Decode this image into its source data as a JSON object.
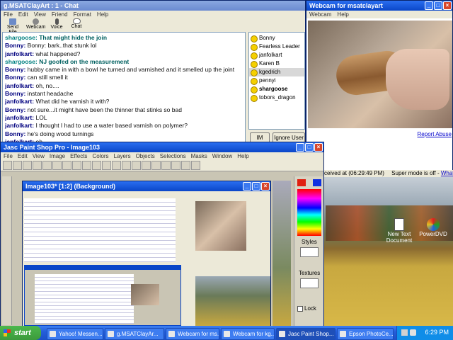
{
  "chat_window": {
    "title": "g.MSATClayArt : 1 - Chat",
    "menu": [
      "File",
      "Edit",
      "View",
      "Friend",
      "Format",
      "Help"
    ],
    "toolbar": [
      "Send File",
      "Webcam",
      "Voice",
      "Chat"
    ],
    "messages": [
      {
        "nick": "shargoose:",
        "text": "That might hide the join",
        "style": "bold"
      },
      {
        "nick": "Bonny:",
        "text": "Bonny: bark..that stunk lol",
        "style": "plain"
      },
      {
        "nick": "janfolkart:",
        "text": "what happened?",
        "style": "plain"
      },
      {
        "nick": "shargoose:",
        "text": "NJ goofed on the measurement",
        "style": "bold"
      },
      {
        "nick": "Bonny:",
        "text": "hubby came in with a bowl he turned and varnished and it smelled up the joint",
        "style": "plain"
      },
      {
        "nick": "Bonny:",
        "text": "can still smell it",
        "style": "plain"
      },
      {
        "nick": "janfolkart:",
        "text": "oh, no....",
        "style": "plain"
      },
      {
        "nick": "Bonny:",
        "text": "instant headache",
        "style": "plain"
      },
      {
        "nick": "janfolkart:",
        "text": "What did he varnish it with?",
        "style": "plain"
      },
      {
        "nick": "Bonny:",
        "text": "not sure...it might have been the thinner that stinks so bad",
        "style": "plain"
      },
      {
        "nick": "janfolkart:",
        "text": "LOL",
        "style": "plain"
      },
      {
        "nick": "janfolkart:",
        "text": "I thought I had to use a water based varnish on polymer?",
        "style": "plain"
      },
      {
        "nick": "Bonny:",
        "text": "he's doing wood turnings",
        "style": "plain"
      },
      {
        "nick": "janfolkart:",
        "text": "oh",
        "style": "plain"
      }
    ],
    "users": [
      "Bonny",
      "Fearless Leader",
      "janfolkart",
      "Karen B",
      "kgedrich",
      "pennyi",
      "shargoose",
      "tobors_dragon"
    ],
    "selected_user": "kgedrich",
    "im_button": "IM",
    "ignore_button": "Ignore User"
  },
  "webcam_window": {
    "title": "Webcam for msatclayart",
    "menu": [
      "Webcam",
      "Help"
    ],
    "report_link": "Report Abuse",
    "received_text": "ceived at (06:29:49 PM)",
    "super_mode_text": "Super mode is off -",
    "whats_this_link": "What's this?"
  },
  "psp_window": {
    "title": "Jasc Paint Shop Pro - Image103",
    "menu": [
      "File",
      "Edit",
      "View",
      "Image",
      "Effects",
      "Colors",
      "Layers",
      "Objects",
      "Selections",
      "Masks",
      "Window",
      "Help"
    ],
    "image_title": "Image103* [1:2] (Background)",
    "panel_styles": "Styles",
    "panel_textures": "Textures",
    "lock_label": "Lock"
  },
  "desktop": {
    "icons": [
      "New Text Document",
      "PowerDVD"
    ]
  },
  "taskbar": {
    "start_label": "start",
    "tasks": [
      "Yahoo! Messen...",
      "g.MSATClayAr...",
      "Webcam for ms...",
      "Webcam for kg...",
      "Jasc Paint Shop...",
      "Epson PhotoCe..."
    ],
    "clock": "6:29 PM"
  },
  "colors": {
    "title_active": "#0a46c8",
    "taskbar": "#245edb",
    "start_green": "#3c9a3c",
    "chat_nick": "#00007f",
    "chat_bold": "#006060"
  }
}
